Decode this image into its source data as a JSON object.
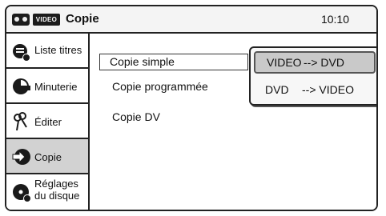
{
  "header": {
    "video_badge": "VIDEO",
    "title": "Copie",
    "clock": "10:10"
  },
  "sidebar": {
    "items": [
      {
        "label": "Liste titres",
        "icon": "title-list-icon"
      },
      {
        "label": "Minuterie",
        "icon": "timer-icon"
      },
      {
        "label": "Éditer",
        "icon": "scissors-icon"
      },
      {
        "label": "Copie",
        "icon": "copy-arrow-icon",
        "active": true
      },
      {
        "label_line1": "Réglages",
        "label_line2": "du disque",
        "icon": "disc-settings-icon"
      }
    ]
  },
  "main": {
    "items": [
      {
        "label": "Copie simple",
        "selected": true
      },
      {
        "label": "Copie programmée"
      },
      {
        "label": "Copie DV"
      }
    ]
  },
  "submenu": {
    "options": [
      {
        "from": "VIDEO",
        "to": "--> DVD",
        "selected": true
      },
      {
        "from": "DVD",
        "to": "--> VIDEO"
      }
    ]
  },
  "colors": {
    "active_sidebar_bg": "#d2d2d2",
    "selected_option_bg": "#c9c9c9",
    "border": "#222222"
  }
}
